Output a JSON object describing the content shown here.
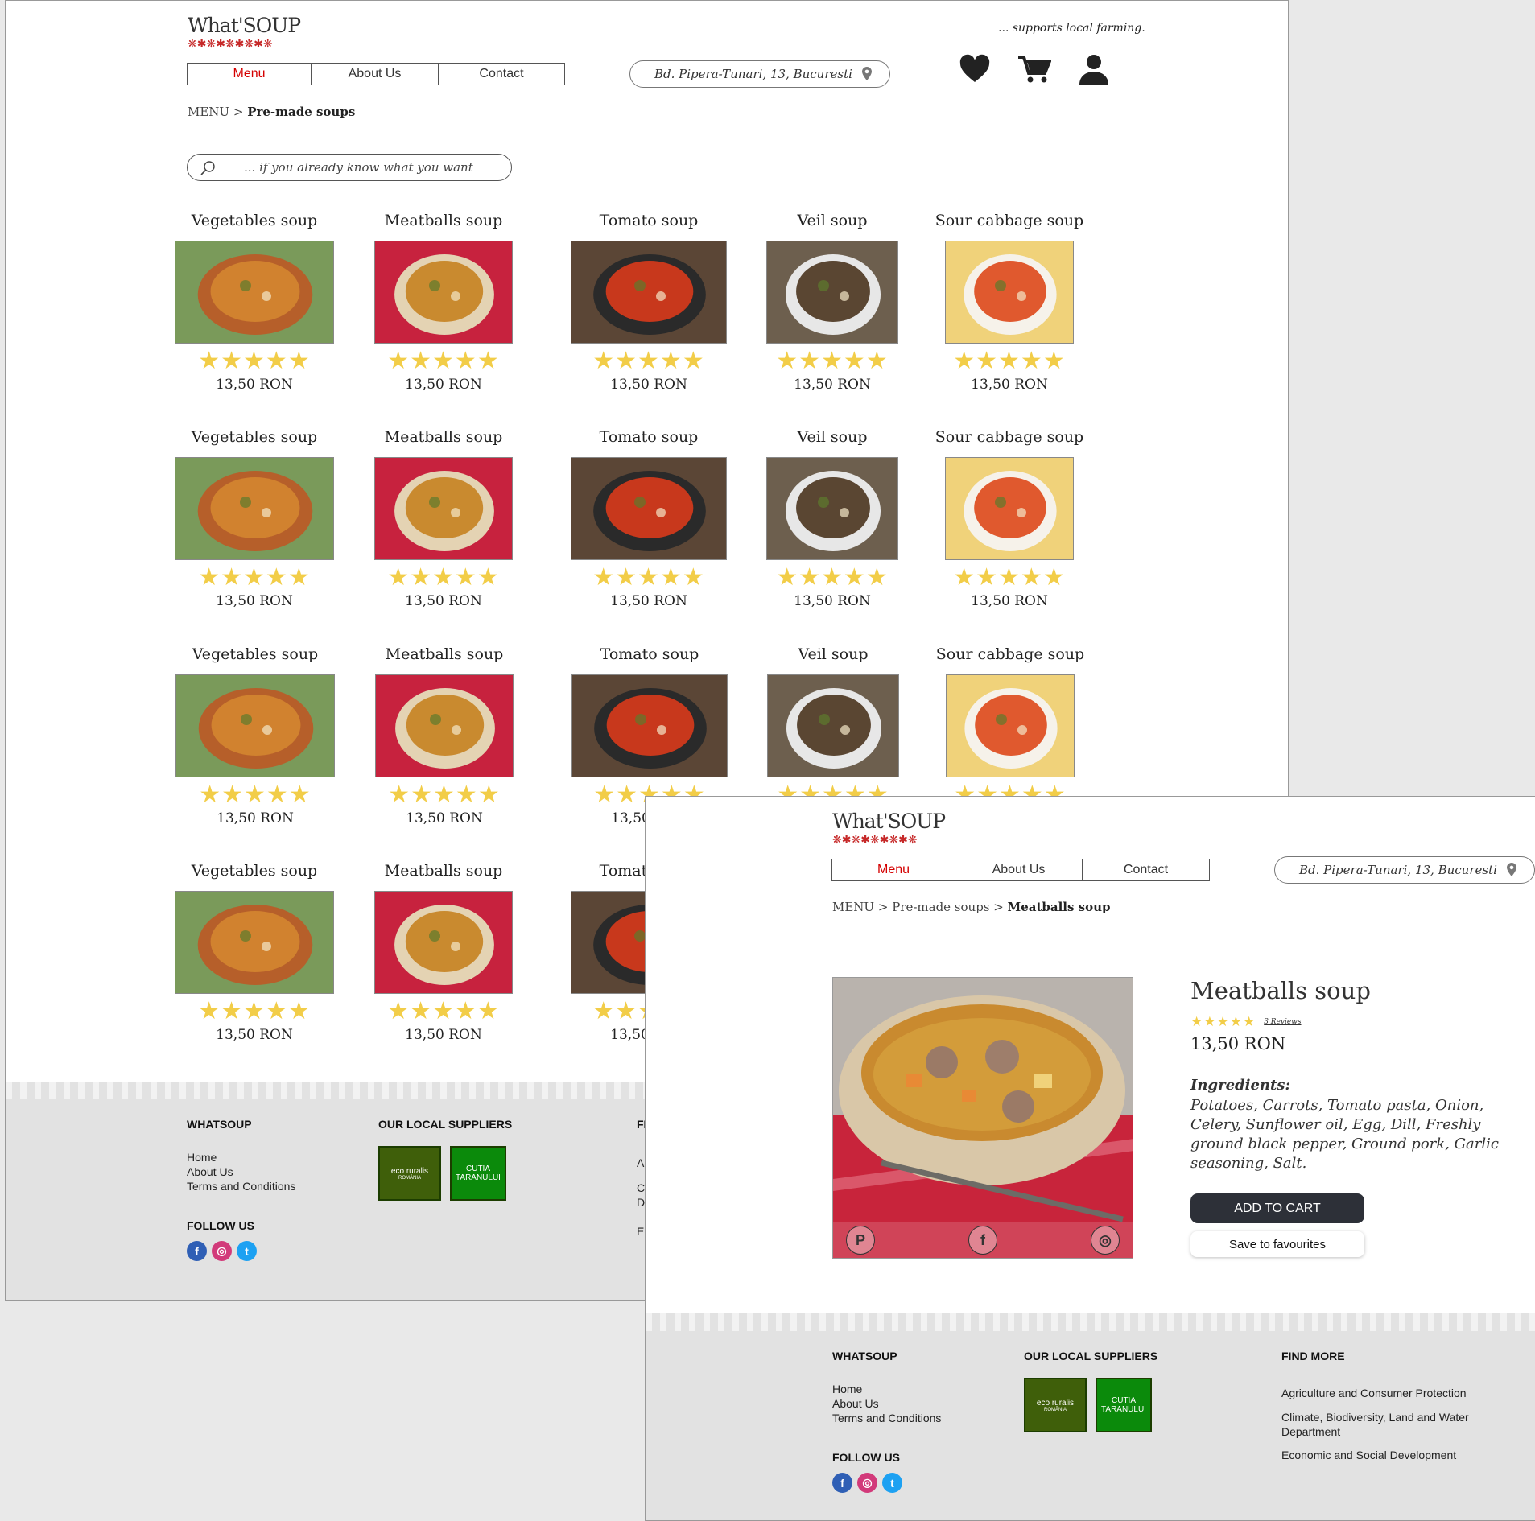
{
  "brand": {
    "name": "What'SOUP",
    "pattern": "❋✱❋✱❋✱❋✱❋",
    "tagline": "... supports local farming."
  },
  "nav": {
    "items": [
      "Menu",
      "About Us",
      "Contact"
    ]
  },
  "address": "Bd. Pipera-Tunari, 13, Bucuresti",
  "icons": {
    "favourites": "heart-icon",
    "cart": "cart-icon",
    "account": "user-icon",
    "location": "map-pin-icon",
    "search": "search-icon"
  },
  "list_page": {
    "breadcrumb": {
      "root": "MENU",
      "sep": " > ",
      "current": "Pre-made soups"
    },
    "search_placeholder": "... if you already know what you want",
    "products": [
      {
        "name": "Vegetables soup",
        "price": "13,50 RON",
        "rating": 5
      },
      {
        "name": "Meatballs soup",
        "price": "13,50 RON",
        "rating": 5
      },
      {
        "name": "Tomato soup",
        "price": "13,50 RON",
        "rating": 5
      },
      {
        "name": "Veil soup",
        "price": "13,50 RON",
        "rating": 5
      },
      {
        "name": "Sour cabbage soup",
        "price": "13,50 RON",
        "rating": 5
      }
    ],
    "visible_partial_labels": {
      "price_partial": "13",
      "price_partial_2": "13,",
      "title_partial": "Tom"
    }
  },
  "detail_page": {
    "breadcrumb": {
      "root": "MENU",
      "sep": " > ",
      "middle": "Pre-made soups",
      "current": "Meatballs soup"
    },
    "title": "Meatballs soup",
    "rating": 5,
    "reviews": "3 Reviews",
    "price": "13,50 RON",
    "ingredients_label": "Ingredients:",
    "ingredients": "Potatoes, Carrots, Tomato pasta, Onion, Celery, Sunflower oil, Egg, Dill, Freshly ground black pepper, Ground pork, Garlic seasoning, Salt.",
    "add_to_cart": "ADD TO CART",
    "save_favourites": "Save to favourites",
    "share": [
      "pinterest-icon",
      "facebook-icon",
      "instagram-icon"
    ],
    "share_glyphs": [
      "P",
      "f",
      "◎"
    ]
  },
  "footer": {
    "whatsoup_heading": "WHATSOUP",
    "links": [
      "Home",
      "About Us",
      "Terms and Conditions"
    ],
    "follow_heading": "FOLLOW US",
    "social_glyphs": [
      "f",
      "◎",
      "t"
    ],
    "suppliers_heading": "OUR LOCAL SUPPLIERS",
    "suppliers": [
      {
        "name": "eco ruralis",
        "sub": "ROMÂNIA"
      },
      {
        "name": "CUTIA",
        "sub": "TARANULUI"
      }
    ],
    "find_more_heading": "FIND MORE",
    "find_more": [
      "Agriculture and Consumer Protection",
      "Climate, Biodiversity, Land and Water Department",
      "Economic and Social Development"
    ],
    "partial_find_more": {
      "heading": "FI",
      "l1": "Ag",
      "l2a": "Cl",
      "l2b": "D",
      "l3": "Ec"
    }
  },
  "colors": {
    "active_nav": "#d40000",
    "star": "#f2cd48",
    "cart_button": "#2d3038",
    "footer_bg": "#e2e2e2"
  }
}
